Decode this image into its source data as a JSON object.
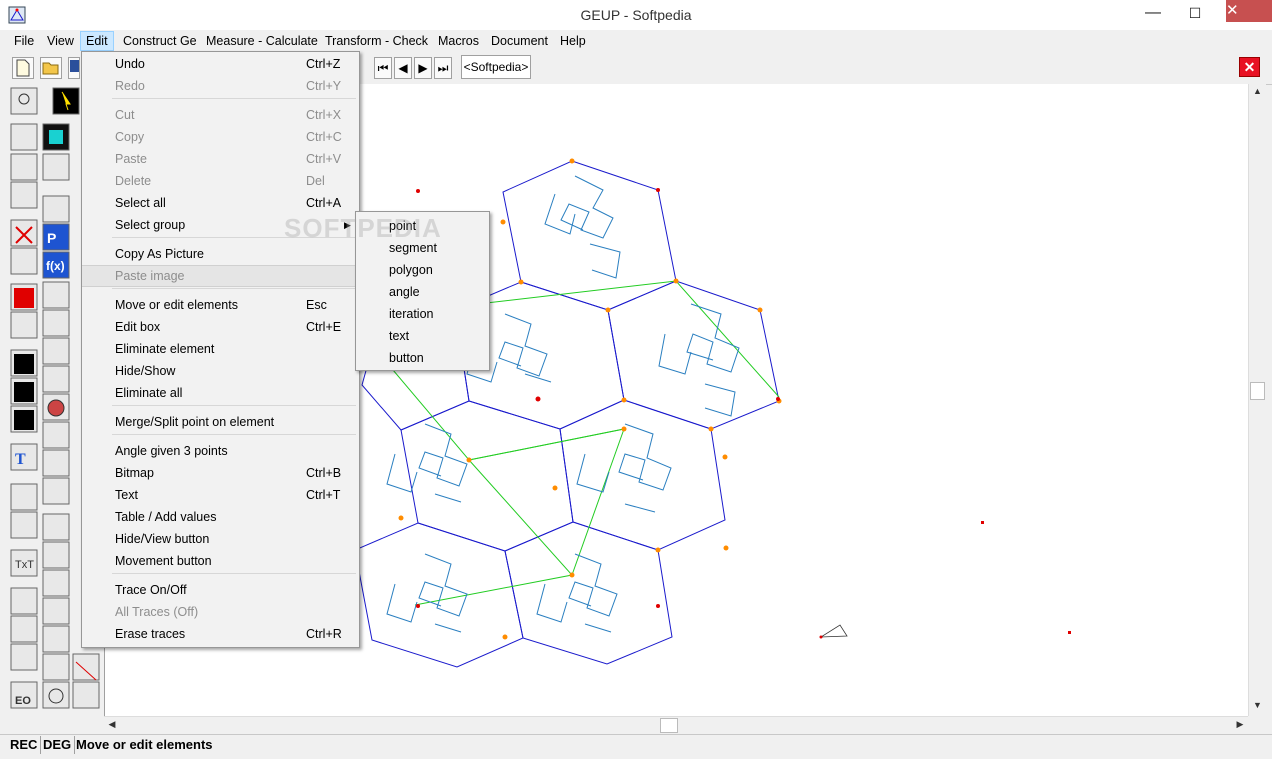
{
  "window": {
    "title": "GEUP - Softpedia",
    "minimize": "—",
    "maximize": "☐",
    "close": "✕"
  },
  "menubar": [
    "File",
    "View",
    "Edit",
    "Construct Ge",
    "Measure - Calculate",
    "Transform - Check",
    "Macros",
    "Document",
    "Help"
  ],
  "toolbar": {
    "document_tab": "<Softpedia>",
    "nav": [
      "⏮",
      "◀",
      "▶",
      "⏭"
    ],
    "close_doc": "✕"
  },
  "edit_menu": [
    {
      "label": "Undo",
      "shortcut": "Ctrl+Z",
      "enabled": true
    },
    {
      "label": "Redo",
      "shortcut": "Ctrl+Y",
      "enabled": false
    },
    {
      "label": "Cut",
      "shortcut": "Ctrl+X",
      "enabled": false
    },
    {
      "label": "Copy",
      "shortcut": "Ctrl+C",
      "enabled": false
    },
    {
      "label": "Paste",
      "shortcut": "Ctrl+V",
      "enabled": false
    },
    {
      "label": "Delete",
      "shortcut": "Del",
      "enabled": false
    },
    {
      "label": "Select all",
      "shortcut": "Ctrl+A",
      "enabled": true
    },
    {
      "label": "Select group",
      "shortcut": "",
      "enabled": true,
      "submenu": true
    },
    {
      "label": "Copy As Picture",
      "shortcut": "",
      "enabled": true
    },
    {
      "label": "Paste image",
      "shortcut": "",
      "enabled": false,
      "highlighted": true
    },
    {
      "label": "Move or edit elements",
      "shortcut": "Esc",
      "enabled": true
    },
    {
      "label": "Edit box",
      "shortcut": "Ctrl+E",
      "enabled": true
    },
    {
      "label": "Eliminate element",
      "shortcut": "",
      "enabled": true
    },
    {
      "label": "Hide/Show",
      "shortcut": "",
      "enabled": true
    },
    {
      "label": "Eliminate all",
      "shortcut": "",
      "enabled": true
    },
    {
      "label": "Merge/Split point on element",
      "shortcut": "",
      "enabled": true
    },
    {
      "label": "Angle given 3 points",
      "shortcut": "",
      "enabled": true
    },
    {
      "label": "Bitmap",
      "shortcut": "Ctrl+B",
      "enabled": true
    },
    {
      "label": "Text",
      "shortcut": "Ctrl+T",
      "enabled": true
    },
    {
      "label": "Table / Add values",
      "shortcut": "",
      "enabled": true
    },
    {
      "label": "Hide/View button",
      "shortcut": "",
      "enabled": true
    },
    {
      "label": "Movement button",
      "shortcut": "",
      "enabled": true
    },
    {
      "label": "Trace On/Off",
      "shortcut": "",
      "enabled": true
    },
    {
      "label": "All Traces (Off)",
      "shortcut": "",
      "enabled": false
    },
    {
      "label": "Erase traces",
      "shortcut": "Ctrl+R",
      "enabled": true
    }
  ],
  "select_group_submenu": [
    "point",
    "segment",
    "polygon",
    "angle",
    "iteration",
    "text",
    "button"
  ],
  "watermark": "SOFTPEDIA",
  "status": {
    "rec": "REC",
    "deg": "DEG",
    "mode": "Move or edit elements"
  },
  "colors": {
    "polygon": "#1a1acc",
    "curve": "#2a7fc0",
    "green": "#22cc22",
    "orange_point": "#ff8c00",
    "red_point": "#e00000",
    "close_button": "#c75050"
  }
}
